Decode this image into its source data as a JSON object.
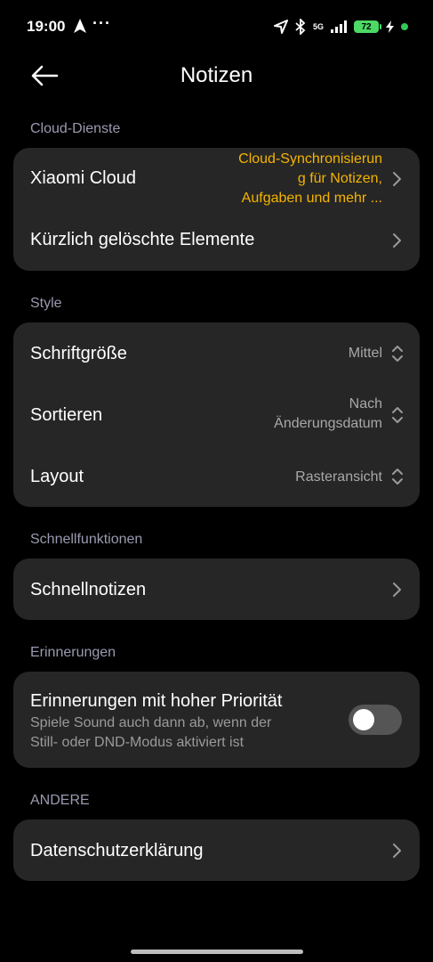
{
  "status_bar": {
    "time": "19:00",
    "dots": "···",
    "network": "5G",
    "battery": "72"
  },
  "header": {
    "title": "Notizen",
    "back_icon": "arrow-left-icon"
  },
  "sections": {
    "cloud": {
      "label": "Cloud-Dienste",
      "xiaomi_cloud": {
        "label": "Xiaomi Cloud",
        "value_line1": "Cloud-Synchronisierun",
        "value_line2": "g für Notizen,",
        "value_line3": "Aufgaben und mehr ..."
      },
      "deleted": {
        "label": "Kürzlich gelöschte Elemente"
      }
    },
    "style": {
      "label": "Style",
      "font_size": {
        "label": "Schriftgröße",
        "value": "Mittel"
      },
      "sort": {
        "label": "Sortieren",
        "value_line1": "Nach",
        "value_line2": "Änderungsdatum"
      },
      "layout": {
        "label": "Layout",
        "value": "Rasteransicht"
      }
    },
    "quick": {
      "label": "Schnellfunktionen",
      "quick_notes": {
        "label": "Schnellnotizen"
      }
    },
    "reminders": {
      "label": "Erinnerungen",
      "high_priority": {
        "label": "Erinnerungen mit hoher Priorität",
        "desc_line1": "Spiele Sound auch dann ab, wenn der",
        "desc_line2": "Still- oder DND-Modus aktiviert ist",
        "enabled": false
      }
    },
    "other": {
      "label": "ANDERE",
      "privacy": {
        "label": "Datenschutzerklärung"
      }
    }
  },
  "colors": {
    "background": "#000000",
    "card": "#262626",
    "accent": "#f5b400",
    "section_label": "#9a9ab0"
  }
}
